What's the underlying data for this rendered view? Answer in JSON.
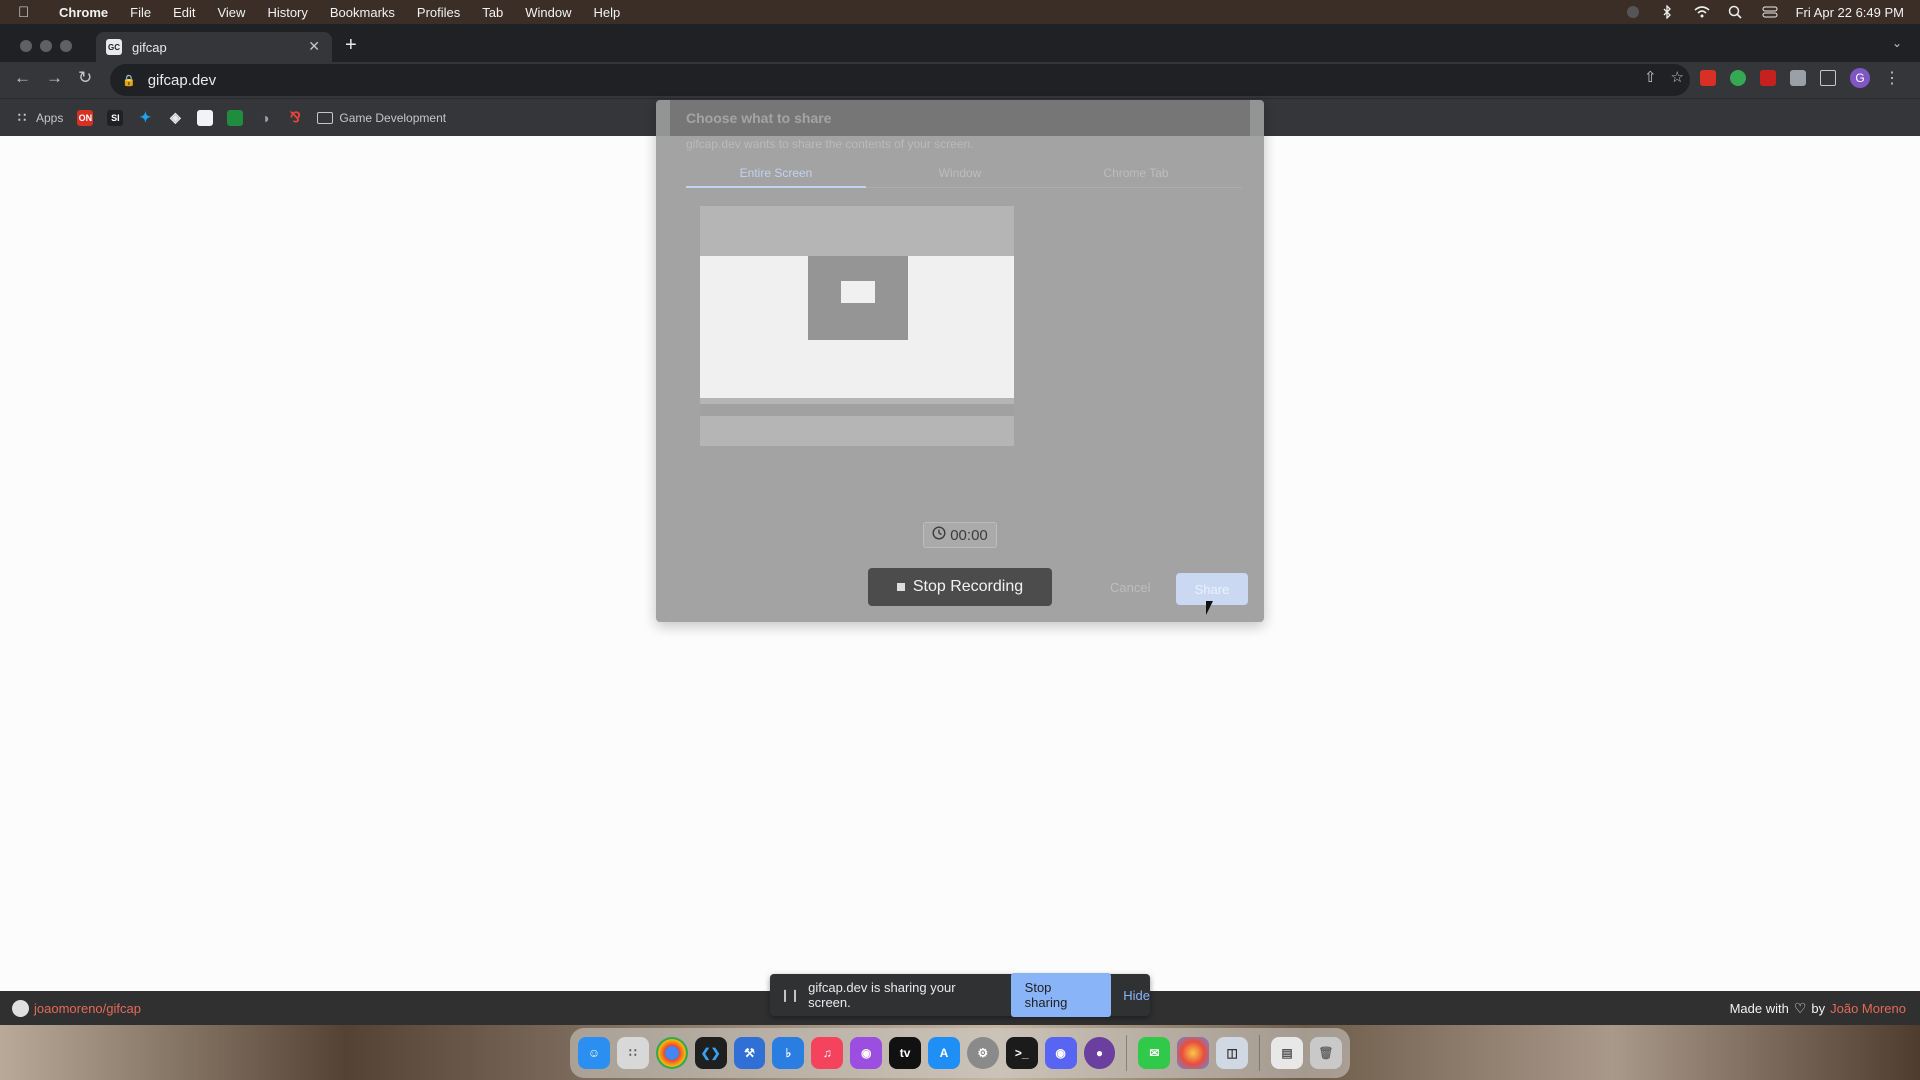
{
  "menubar": {
    "app": "Chrome",
    "items": [
      "File",
      "Edit",
      "View",
      "History",
      "Bookmarks",
      "Profiles",
      "Tab",
      "Window",
      "Help"
    ],
    "datetime": "Fri Apr 22  6:49 PM"
  },
  "browser": {
    "tab_title": "gifcap",
    "favicon_text": "GC",
    "url": "gifcap.dev",
    "profile_initial": "G",
    "bookmarks": {
      "apps_label": "Apps",
      "items": [
        "ON",
        "SI"
      ],
      "folder_label": "Game Development"
    }
  },
  "dialog": {
    "title": "Choose what to share",
    "subtitle": "gifcap.dev wants to share the contents of your screen.",
    "tabs": [
      "Entire Screen",
      "Window",
      "Chrome Tab"
    ],
    "active_tab": "Entire Screen",
    "cancel_label": "Cancel",
    "share_label": "Share"
  },
  "recorder": {
    "timer": "00:00",
    "stop_label": "Stop Recording"
  },
  "share_notice": {
    "message": "gifcap.dev is sharing your screen.",
    "stop_label": "Stop sharing",
    "hide_label": "Hide"
  },
  "footer": {
    "repo": "joaomoreno/gifcap",
    "made_with": "Made with",
    "by": "by",
    "author": "João Moreno"
  },
  "dock": {
    "apps": [
      "finder",
      "launchpad",
      "chrome",
      "vscode",
      "xcode",
      "instruments",
      "music",
      "podcasts",
      "tv",
      "app-store",
      "system-preferences",
      "terminal",
      "discord",
      "tor",
      "messages",
      "photos",
      "preview",
      "documents",
      "trash"
    ]
  },
  "colors": {
    "accent": "#8ab4f8",
    "link": "#e46a5a",
    "footer_bg": "#303030"
  }
}
